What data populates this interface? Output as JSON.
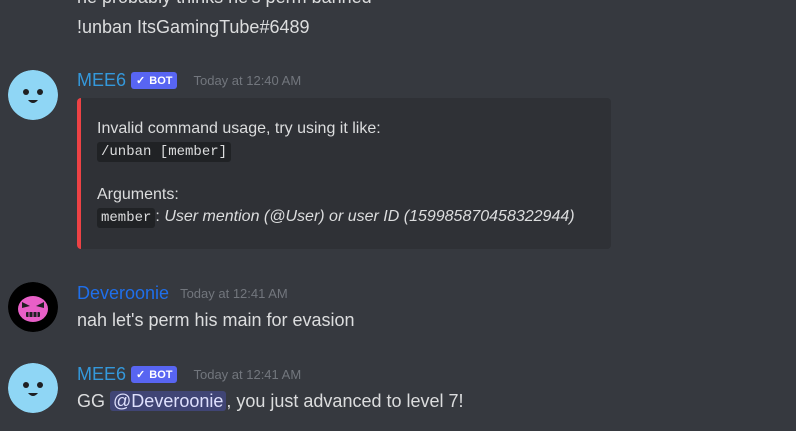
{
  "colors": {
    "background": "#36393f",
    "embed_background": "#2f3136",
    "embed_accent": "#ed4245",
    "bot_tag": "#5865f2",
    "mee6_name": "#3498db",
    "deveroonie_name": "#1f6feb",
    "timestamp": "#72767d",
    "text": "#dcddde"
  },
  "messages": {
    "prev_partial_text": "he probably thinks he's perm banned",
    "prev_command_text": "!unban ItsGamingTube#6489",
    "msg1": {
      "author": "MEE6",
      "bot_tag": "BOT",
      "timestamp": "Today at 12:40 AM",
      "avatar_icon": "mee6-avatar-icon",
      "embed": {
        "line1": "Invalid command usage, try using it like:",
        "usage_code": "/unban [member]",
        "arguments_label": "Arguments:",
        "arg_name": "member",
        "arg_sep": ":",
        "arg_desc": "User mention (@User) or user ID (159985870458322944)"
      }
    },
    "msg2": {
      "author": "Deveroonie",
      "timestamp": "Today at 12:41 AM",
      "avatar_icon": "deveroonie-avatar-icon",
      "text": "nah let's perm his main for evasion"
    },
    "msg3": {
      "author": "MEE6",
      "bot_tag": "BOT",
      "timestamp": "Today at 12:41 AM",
      "avatar_icon": "mee6-avatar-icon",
      "text_prefix": "GG",
      "mention": "@Deveroonie",
      "text_suffix": ", you just advanced to level 7!"
    }
  }
}
